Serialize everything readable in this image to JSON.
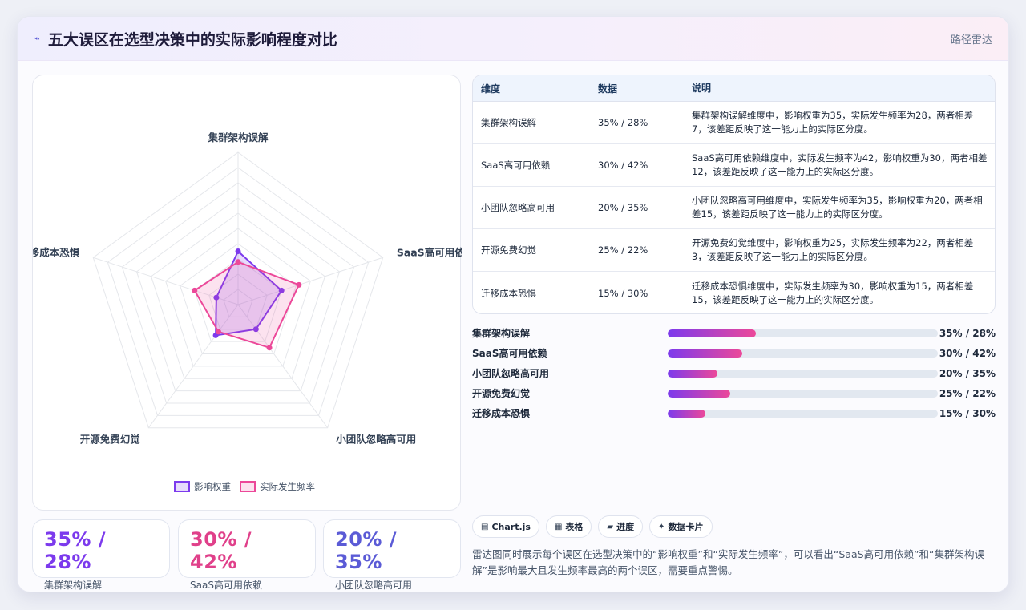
{
  "header": {
    "title": "五大误区在选型决策中的实际影响程度对比",
    "right_label": "路径雷达",
    "icon": "lightning-icon"
  },
  "chart_data": {
    "type": "radar",
    "categories": [
      "集群架构误解",
      "SaaS高可用依赖",
      "小团队忽略高可用",
      "开源免费幻觉",
      "迁移成本恐惧"
    ],
    "series": [
      {
        "name": "影响权重",
        "values": [
          35,
          30,
          20,
          25,
          15
        ],
        "color": "#7c3aed"
      },
      {
        "name": "实际发生频率",
        "values": [
          28,
          42,
          35,
          22,
          30
        ],
        "color": "#ec4899"
      }
    ],
    "rlim": [
      0,
      100
    ],
    "grid": true,
    "legend_position": "bottom"
  },
  "stats": [
    {
      "value": "35% / 28%",
      "label": "集群架构误解",
      "color": "#7c3aed"
    },
    {
      "value": "30% / 42%",
      "label": "SaaS高可用依赖",
      "color": "#e0408a"
    },
    {
      "value": "20% / 35%",
      "label": "小团队忽略高可用",
      "color": "#5b5bd6"
    }
  ],
  "table": {
    "headers": [
      "维度",
      "数据",
      "说明"
    ],
    "rows": [
      {
        "dim": "集群架构误解",
        "data": "35% / 28%",
        "desc": "集群架构误解维度中，影响权重为35，实际发生频率为28，两者相差7，该差距反映了这一能力上的实际区分度。"
      },
      {
        "dim": "SaaS高可用依赖",
        "data": "30% / 42%",
        "desc": "SaaS高可用依赖维度中，实际发生频率为42，影响权重为30，两者相差12，该差距反映了这一能力上的实际区分度。"
      },
      {
        "dim": "小团队忽略高可用",
        "data": "20% / 35%",
        "desc": "小团队忽略高可用维度中，实际发生频率为35，影响权重为20，两者相差15，该差距反映了这一能力上的实际区分度。"
      },
      {
        "dim": "开源免费幻觉",
        "data": "25% / 22%",
        "desc": "开源免费幻觉维度中，影响权重为25，实际发生频率为22，两者相差3，该差距反映了这一能力上的实际区分度。"
      },
      {
        "dim": "迁移成本恐惧",
        "data": "15% / 30%",
        "desc": "迁移成本恐惧维度中，实际发生频率为30，影响权重为15，两者相差15，该差距反映了这一能力上的实际区分度。"
      }
    ]
  },
  "progress": [
    {
      "label": "集群架构误解",
      "value": "35% / 28%",
      "fill": 0.325
    },
    {
      "label": "SaaS高可用依赖",
      "value": "30% / 42%",
      "fill": 0.275
    },
    {
      "label": "小团队忽略高可用",
      "value": "20% / 35%",
      "fill": 0.185
    },
    {
      "label": "开源免费幻觉",
      "value": "25% / 22%",
      "fill": 0.23
    },
    {
      "label": "迁移成本恐惧",
      "value": "15% / 30%",
      "fill": 0.14
    }
  ],
  "chips": [
    {
      "icon": "▤",
      "label": "Chart.js"
    },
    {
      "icon": "▦",
      "label": "表格"
    },
    {
      "icon": "▰",
      "label": "进度"
    },
    {
      "icon": "✦",
      "label": "数据卡片"
    }
  ],
  "note": "雷达图同时展示每个误区在选型决策中的“影响权重”和“实际发生频率”，可以看出“SaaS高可用依赖”和“集群架构误解”是影响最大且发生频率最高的两个误区，需要重点警惕。"
}
